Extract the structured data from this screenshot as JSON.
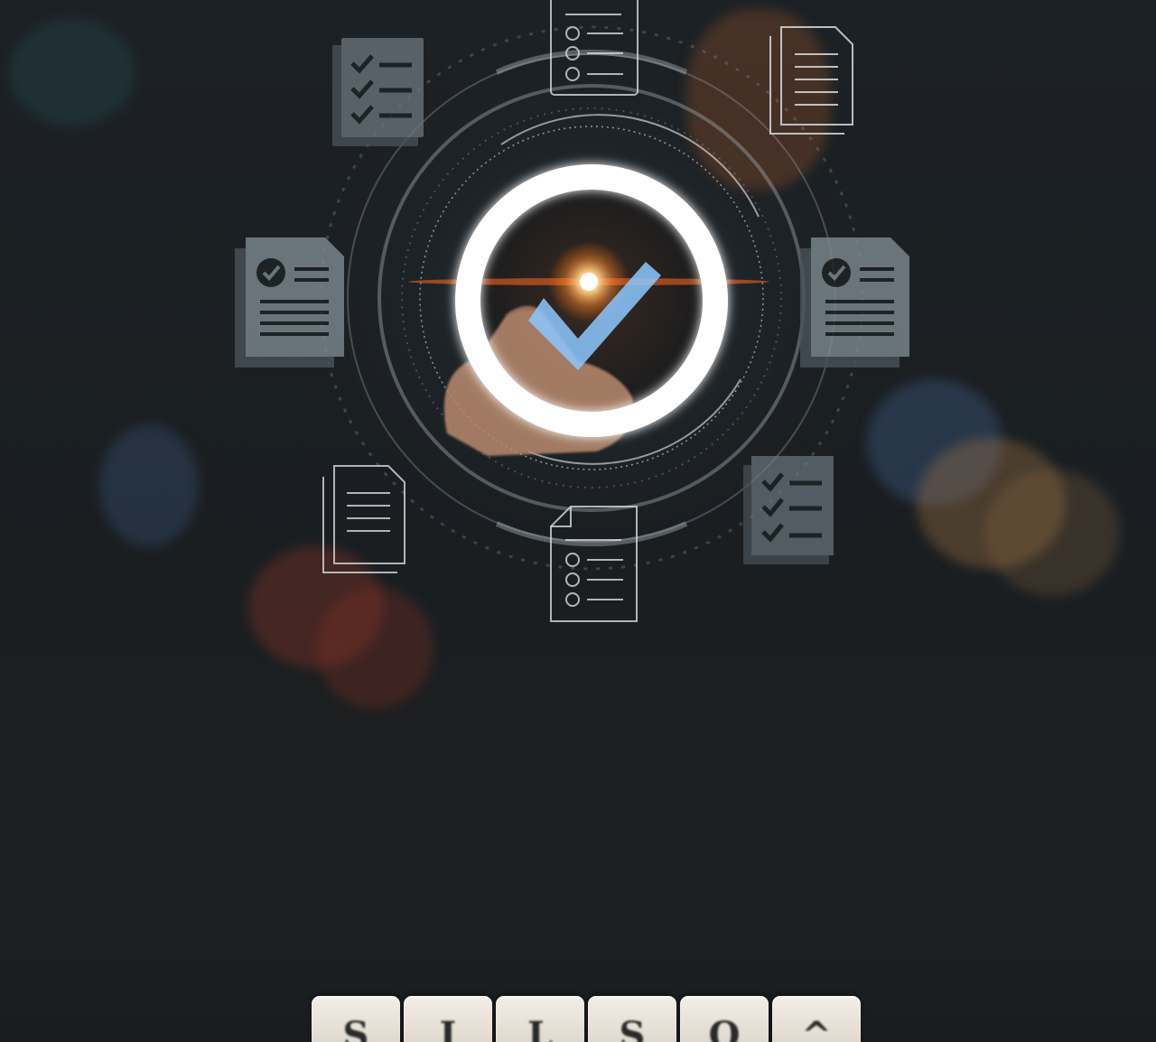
{
  "scene": {
    "description_icons": [
      "checklist-document-icon",
      "copy-documents-icon",
      "approved-document-icon",
      "hand-pointing-icon",
      "check-mark-icon"
    ]
  },
  "colors": {
    "background": "#1b1f22",
    "ring": "#ffffff",
    "checkmark": "#7fbfff",
    "flare": "#ff9a3c",
    "icon_fill": "#7a8a93"
  }
}
